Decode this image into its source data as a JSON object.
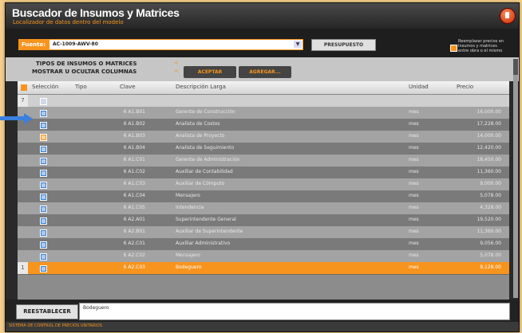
{
  "window": {
    "title": "Buscador de Insumos y Matrices",
    "subtitle": "Localizador de datos dentro del modelo"
  },
  "toolbar": {
    "fuente_label": "Fuente:",
    "fuente_value": "AC-1009-AWV-80",
    "presupuesto_label": "PRESUPUESTO",
    "replace_option": [
      "Reemplazar precios en",
      "Insumos y matrices",
      "entre obra o el mismo"
    ],
    "replace_checked": true
  },
  "filters": {
    "label_types": "TIPOS DE INSUMOS O MATRICES",
    "label_columns": "MOSTRAR U OCULTAR COLUMNAS",
    "accept_label": "ACEPTAR",
    "add_label": "AGREGAR..."
  },
  "grid": {
    "columns": [
      "Selección",
      "Tipo",
      "Clave",
      "Descripción Larga",
      "Unidad",
      "Precio"
    ],
    "filter_row_indicator": "7",
    "rows": [
      {
        "checked": true,
        "clave": "6 A1.B01",
        "descripcion": "Gerente de Construcción",
        "unidad": "mes",
        "precio": "16,000.00"
      },
      {
        "checked": true,
        "clave": "6 A1.B02",
        "descripcion": "Analista de Costos",
        "unidad": "mes",
        "precio": "17,228.00"
      },
      {
        "checked": true,
        "orange": true,
        "clave": "6 A1.B03",
        "descripcion": "Analista de Proyecto",
        "unidad": "mes",
        "precio": "14,000.00"
      },
      {
        "checked": true,
        "clave": "6 A1.B04",
        "descripcion": "Analista de Seguimiento",
        "unidad": "mes",
        "precio": "12,420.00"
      },
      {
        "checked": true,
        "clave": "6 A1.C01",
        "descripcion": "Gerente de Administración",
        "unidad": "mes",
        "precio": "18,450.00"
      },
      {
        "checked": true,
        "clave": "6 A1.C02",
        "descripcion": "Auxiliar de Contabilidad",
        "unidad": "mes",
        "precio": "11,360.00"
      },
      {
        "checked": true,
        "clave": "6 A1.C03",
        "descripcion": "Auxiliar de Cómputo",
        "unidad": "mes",
        "precio": "9,000.00"
      },
      {
        "checked": true,
        "clave": "6 A1.C04",
        "descripcion": "Mensajero",
        "unidad": "mes",
        "precio": "5,078.00"
      },
      {
        "checked": true,
        "clave": "6 A1.C05",
        "descripcion": "Intendencia",
        "unidad": "mes",
        "precio": "4,328.00"
      },
      {
        "checked": true,
        "clave": "6 A2.A01",
        "descripcion": "Superintendente General",
        "unidad": "mes",
        "precio": "19,520.00"
      },
      {
        "checked": true,
        "clave": "6 A2.B01",
        "descripcion": "Auxiliar de Superintendente",
        "unidad": "mes",
        "precio": "11,360.00"
      },
      {
        "checked": true,
        "clave": "6 A2.C01",
        "descripcion": "Auxiliar Administrativo",
        "unidad": "mes",
        "precio": "9,056.00"
      },
      {
        "checked": true,
        "clave": "6 A2.C02",
        "descripcion": "Mensajero",
        "unidad": "mes",
        "precio": "5,078.00"
      },
      {
        "checked": true,
        "selected": true,
        "indicator": "1",
        "clave": "6 A2.C03",
        "descripcion": "Bodeguero",
        "unidad": "mes",
        "precio": "9,128.00"
      }
    ]
  },
  "bottom": {
    "reset_label": "REESTABLECER",
    "note_text": "Bodeguero"
  },
  "status_text": "SISTEMA DE CONTROL DE PRECIOS UNITARIOS",
  "colors": {
    "accent": "#f7941d",
    "pointer_arrow": "#3b7fe0"
  }
}
